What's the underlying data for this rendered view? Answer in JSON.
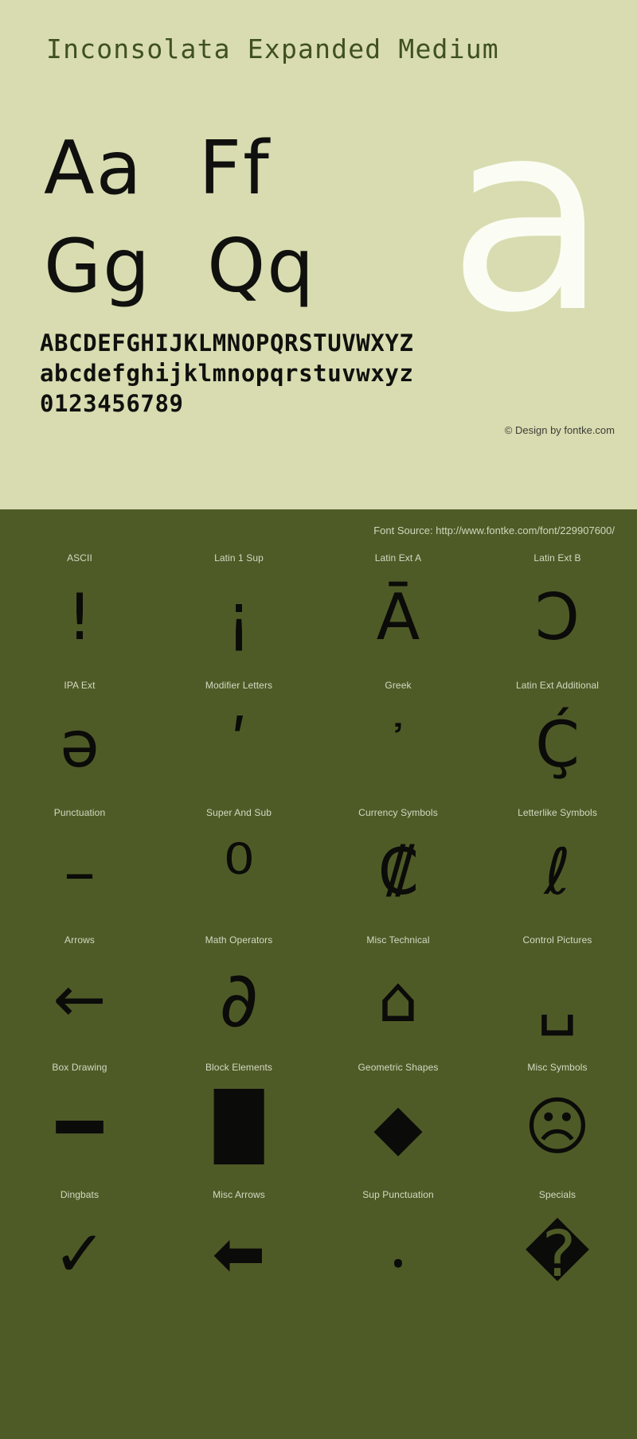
{
  "specimen": {
    "title": "Inconsolata Expanded Medium",
    "sample_pairs": [
      [
        "Aa",
        "Ff"
      ],
      [
        "Gg",
        "Qq"
      ]
    ],
    "watermark_letter": "a",
    "uppercase_line": "ABCDEFGHIJKLMNOPQRSTUVWXYZ",
    "lowercase_line": "abcdefghijklmnopqrstuvwxyz",
    "digits_line": "0123456789",
    "copyright": "© Design by fontke.com",
    "colors": {
      "panel_background": "#d8dcb0",
      "title_color": "#3f5021",
      "glyph_color": "#10100e",
      "watermark_color": "#fbfdf4"
    }
  },
  "blocks_panel": {
    "source_label": "Font Source: http://www.fontke.com/font/229907600/",
    "colors": {
      "background": "#4f5b27",
      "label_color": "#d3d9c2",
      "glyph_color": "#0b0b09"
    },
    "cells": [
      {
        "label": "ASCII",
        "glyph": "!",
        "size": "normal"
      },
      {
        "label": "Latin 1 Sup",
        "glyph": "¡",
        "size": "normal"
      },
      {
        "label": "Latin Ext A",
        "glyph": "Ā",
        "size": "normal"
      },
      {
        "label": "Latin Ext B",
        "glyph": "Ɔ",
        "size": "normal"
      },
      {
        "label": "IPA Ext",
        "glyph": "ə",
        "size": "normal"
      },
      {
        "label": "Modifier Letters",
        "glyph": "ʹ",
        "size": "normal"
      },
      {
        "label": "Greek",
        "glyph": "᾽",
        "size": "small"
      },
      {
        "label": "Latin Ext Additional",
        "glyph": "Ḉ",
        "size": "normal"
      },
      {
        "label": "Punctuation",
        "glyph": "–",
        "size": "normal"
      },
      {
        "label": "Super And Sub",
        "glyph": "⁰",
        "size": "large"
      },
      {
        "label": "Currency Symbols",
        "glyph": "₡",
        "size": "normal"
      },
      {
        "label": "Letterlike Symbols",
        "glyph": "ℓ",
        "size": "normal"
      },
      {
        "label": "Arrows",
        "glyph": "←",
        "size": "normal"
      },
      {
        "label": "Math Operators",
        "glyph": "∂",
        "size": "large"
      },
      {
        "label": "Misc Technical",
        "glyph": "⌂",
        "size": "normal"
      },
      {
        "label": "Control Pictures",
        "glyph": "␣",
        "size": "normal"
      },
      {
        "label": "Box Drawing",
        "glyph": "━",
        "size": "large"
      },
      {
        "label": "Block Elements",
        "glyph": "█",
        "size": "normal"
      },
      {
        "label": "Geometric Shapes",
        "glyph": "◆",
        "size": "normal"
      },
      {
        "label": "Misc Symbols",
        "glyph": "☹",
        "size": "normal"
      },
      {
        "label": "Dingbats",
        "glyph": "✓",
        "size": "normal"
      },
      {
        "label": "Misc Arrows",
        "glyph": "⬅",
        "size": "normal"
      },
      {
        "label": "Sup Punctuation",
        "glyph": "⸳",
        "size": "normal"
      },
      {
        "label": "Specials",
        "glyph": "�",
        "size": "normal"
      }
    ]
  }
}
